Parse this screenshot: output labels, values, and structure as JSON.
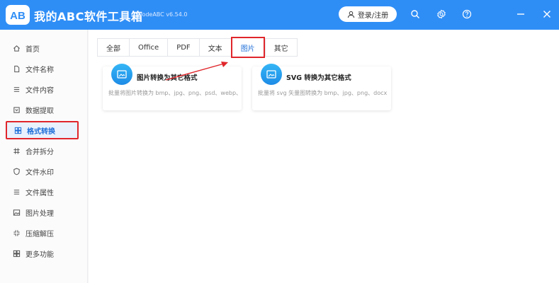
{
  "app": {
    "title": "我的ABC软件工具箱",
    "version": "WodeABC v6.54.0",
    "logo_text": "AB",
    "login_label": "登录/注册"
  },
  "titlebar_icons": [
    "search-icon",
    "gear-icon",
    "help-icon",
    "minimize-icon",
    "close-icon"
  ],
  "sidebar": {
    "items": [
      {
        "label": "首页",
        "icon": "home-icon"
      },
      {
        "label": "文件名称",
        "icon": "file-icon"
      },
      {
        "label": "文件内容",
        "icon": "list-icon"
      },
      {
        "label": "数据提取",
        "icon": "extract-icon"
      },
      {
        "label": "格式转换",
        "icon": "grid-icon",
        "active": true
      },
      {
        "label": "合并拆分",
        "icon": "hash-icon"
      },
      {
        "label": "文件水印",
        "icon": "shield-icon"
      },
      {
        "label": "文件属性",
        "icon": "list-icon"
      },
      {
        "label": "图片处理",
        "icon": "image-icon"
      },
      {
        "label": "压缩解压",
        "icon": "compress-icon"
      },
      {
        "label": "更多功能",
        "icon": "grid-icon"
      }
    ]
  },
  "tabs": [
    {
      "label": "全部"
    },
    {
      "label": "Office"
    },
    {
      "label": "PDF"
    },
    {
      "label": "文本"
    },
    {
      "label": "图片",
      "active": true
    },
    {
      "label": "其它"
    }
  ],
  "cards": [
    {
      "title": "图片转换为其它格式",
      "desc": "批量将图片转换为 bmp、jpg、png、psd、webp、",
      "icon": "image-convert-icon"
    },
    {
      "title": "SVG 转换为其它格式",
      "desc": "批量将 svg 矢量图转换为 bmp、jpg、png、docx",
      "icon": "svg-convert-icon"
    }
  ],
  "colors": {
    "titlebar": "#2f8ef6",
    "accent": "#1f6fd8",
    "highlight": "#e0262b"
  }
}
